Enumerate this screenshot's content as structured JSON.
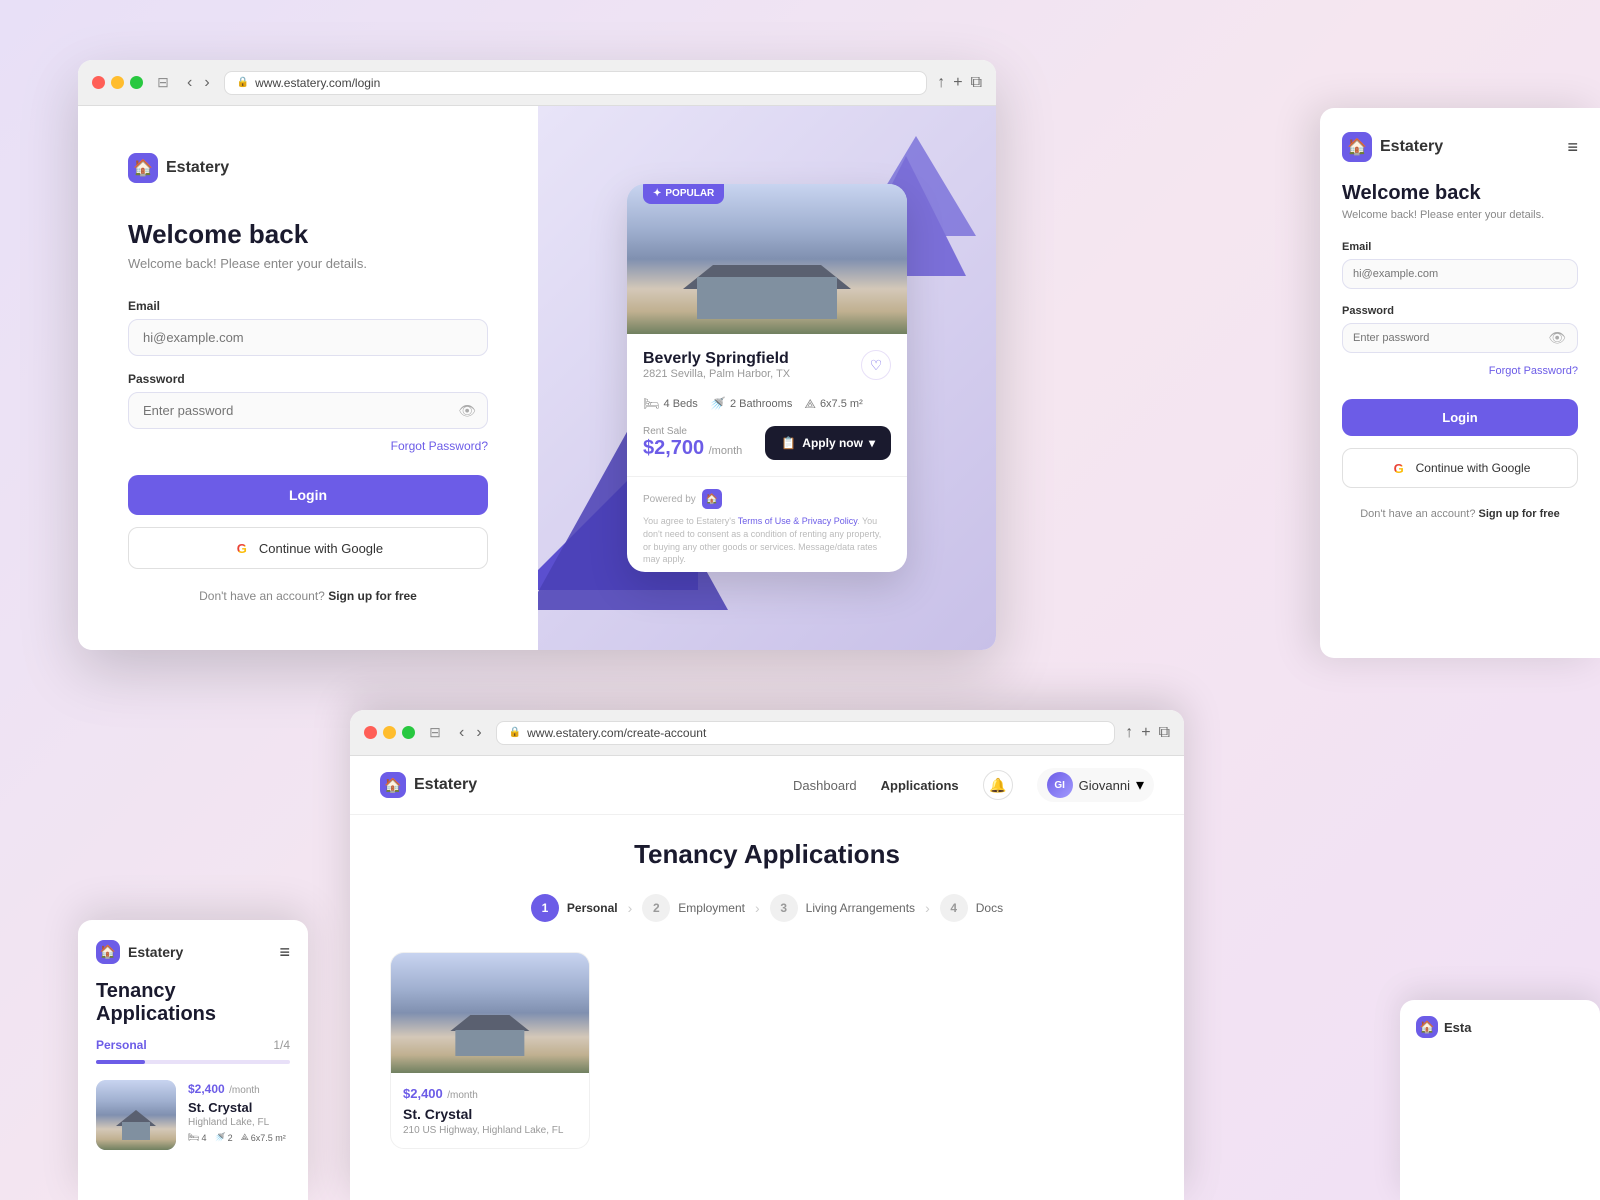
{
  "brand": {
    "name": "Estatery",
    "logo_symbol": "🏠"
  },
  "browser_main": {
    "url": "www.estatery.com/login",
    "login_form": {
      "title": "Welcome back",
      "subtitle": "Welcome back! Please enter your details.",
      "email_label": "Email",
      "email_placeholder": "hi@example.com",
      "password_label": "Password",
      "password_placeholder": "Enter password",
      "forgot_password": "Forgot Password?",
      "login_button": "Login",
      "google_button": "Continue with Google",
      "signup_text": "Don't have an account?",
      "signup_link": "Sign up for free"
    }
  },
  "property_card": {
    "badge": "POPULAR",
    "name": "Beverly Springfield",
    "address": "2821 Sevilla, Palm Harbor, TX",
    "beds": "4 Beds",
    "baths": "2 Bathrooms",
    "area": "6x7.5 m²",
    "rent_label": "Rent Sale",
    "price": "$2,700",
    "period": "/month",
    "apply_button": "Apply now",
    "powered_label": "Powered by",
    "terms": "You agree to Estatery's Terms of Use & Privacy Policy. You don't need to consent as a condition of renting any property, or buying any other goods or services. Message/data rates may apply."
  },
  "panel_right": {
    "title": "Welcome back",
    "subtitle": "Welcome back! Please enter your details.",
    "email_label": "Email",
    "email_placeholder": "hi@example.com",
    "password_label": "Password",
    "password_placeholder": "Enter password",
    "forgot_password": "Forgot Password?",
    "login_button": "Login",
    "google_button": "Continue with Google",
    "signup_text": "Don't have an account?",
    "signup_link": "Sign up for free"
  },
  "tenancy_mobile": {
    "title": "Tenancy Applications",
    "tab_label": "Personal",
    "progress": "1/4",
    "progress_pct": 25,
    "property_price": "$2,400",
    "property_period": "/month",
    "property_name": "St. Crystal",
    "property_location": "Highland Lake, FL",
    "beds": "4",
    "baths": "2",
    "area": "6x7.5 m²"
  },
  "browser_bottom": {
    "url": "www.estatery.com/create-account",
    "nav": {
      "dashboard": "Dashboard",
      "applications": "Applications",
      "user": "Giovanni"
    },
    "page_title": "Tenancy Applications",
    "steps": [
      {
        "num": "1",
        "label": "Personal",
        "active": true
      },
      {
        "num": "2",
        "label": "Employment",
        "active": false
      },
      {
        "num": "3",
        "label": "Living Arrangements",
        "active": false
      },
      {
        "num": "4",
        "label": "Docs",
        "active": false
      }
    ],
    "property_price": "$2,400",
    "property_period": "/month",
    "property_name": "St. Crystal",
    "property_address": "210 US Highway, Highland Lake, FL"
  }
}
